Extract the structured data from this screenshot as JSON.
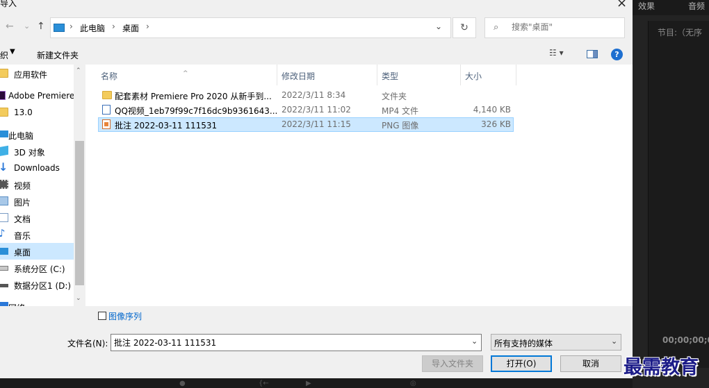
{
  "dialog": {
    "title": "导入",
    "close_glyph": "×"
  },
  "nav": {
    "back_glyph": "←",
    "forward_glyph": "→",
    "recent_glyph": "⌄",
    "up_glyph": "↑"
  },
  "address": {
    "crumbs": [
      "此电脑",
      "桌面"
    ],
    "separator": "›",
    "dropdown_glyph": "⌄",
    "refresh_glyph": "↻"
  },
  "search": {
    "icon": "search-icon",
    "placeholder": "搜索\"桌面\""
  },
  "toolbar": {
    "organize_label": "织",
    "organize_caret": "▼",
    "new_folder_label": "新建文件夹",
    "view_glyph": "☷ ▾",
    "help_glyph": "?"
  },
  "sidebar": {
    "items": [
      {
        "label": "应用软件",
        "icon": "folder-icon",
        "icon_color": "#f3cb5c"
      },
      {
        "label": "Adobe Premiere",
        "icon": "premiere-icon",
        "icon_color": "#2a0a3a"
      },
      {
        "label": "13.0",
        "icon": "folder-icon",
        "icon_color": "#f3cb5c"
      },
      {
        "label": "此电脑",
        "icon": "computer-icon",
        "icon_color": "#2a8fd8"
      },
      {
        "label": "3D 对象",
        "icon": "cube-icon",
        "icon_color": "#3fb0e6"
      },
      {
        "label": "Downloads",
        "icon": "download-icon",
        "icon_color": "#2a78d8"
      },
      {
        "label": "视频",
        "icon": "video-icon",
        "icon_color": "#555555"
      },
      {
        "label": "图片",
        "icon": "picture-icon",
        "icon_color": "#5a8ec4"
      },
      {
        "label": "文档",
        "icon": "document-icon",
        "icon_color": "#7a9cc4"
      },
      {
        "label": "音乐",
        "icon": "music-icon",
        "icon_color": "#2a78d8"
      },
      {
        "label": "桌面",
        "icon": "desktop-icon",
        "icon_color": "#2a8fd8"
      },
      {
        "label": "系统分区 (C:)",
        "icon": "drive-icon",
        "icon_color": "#7a7a7a"
      },
      {
        "label": "数据分区1 (D:)",
        "icon": "drive-icon",
        "icon_color": "#555555"
      },
      {
        "label": "网络",
        "icon": "network-icon",
        "icon_color": "#2a78d8"
      }
    ],
    "selected_label": "桌面",
    "scroll_up": "⌃",
    "scroll_down": "⌄"
  },
  "filelist": {
    "columns": [
      "名称",
      "修改日期",
      "类型",
      "大小"
    ],
    "sort_caret": "^",
    "rows": [
      {
        "name": "配套素材 Premiere Pro 2020 从新手到...",
        "date": "2022/3/11 8:34",
        "type": "文件夹",
        "size": "",
        "icon": "folder-icon"
      },
      {
        "name": "QQ视频_1eb79f99c7f16dc9b9361643...",
        "date": "2022/3/11 11:02",
        "type": "MP4 文件",
        "size": "4,140 KB",
        "icon": "video-file-icon"
      },
      {
        "name": "批注 2022-03-11 111531",
        "date": "2022/3/11 11:15",
        "type": "PNG 图像",
        "size": "326 KB",
        "icon": "image-file-icon"
      }
    ],
    "selected_index": 2
  },
  "options": {
    "image_sequence_label": "图像序列",
    "image_sequence_checked": false
  },
  "footer": {
    "filename_label": "文件名(N):",
    "filename_value": "批注 2022-03-11 111531",
    "filetype_value": "所有支持的媒体",
    "dropdown_glyph": "⌄",
    "import_folder_label": "导入文件夹",
    "open_label": "打开(O)",
    "cancel_label": "取消"
  },
  "background_app": {
    "tab_effects": "效果",
    "tab_audio": "音频",
    "program_label": "节目:（无序",
    "timecode": "00;00;00;0"
  },
  "watermark": "最需教育"
}
